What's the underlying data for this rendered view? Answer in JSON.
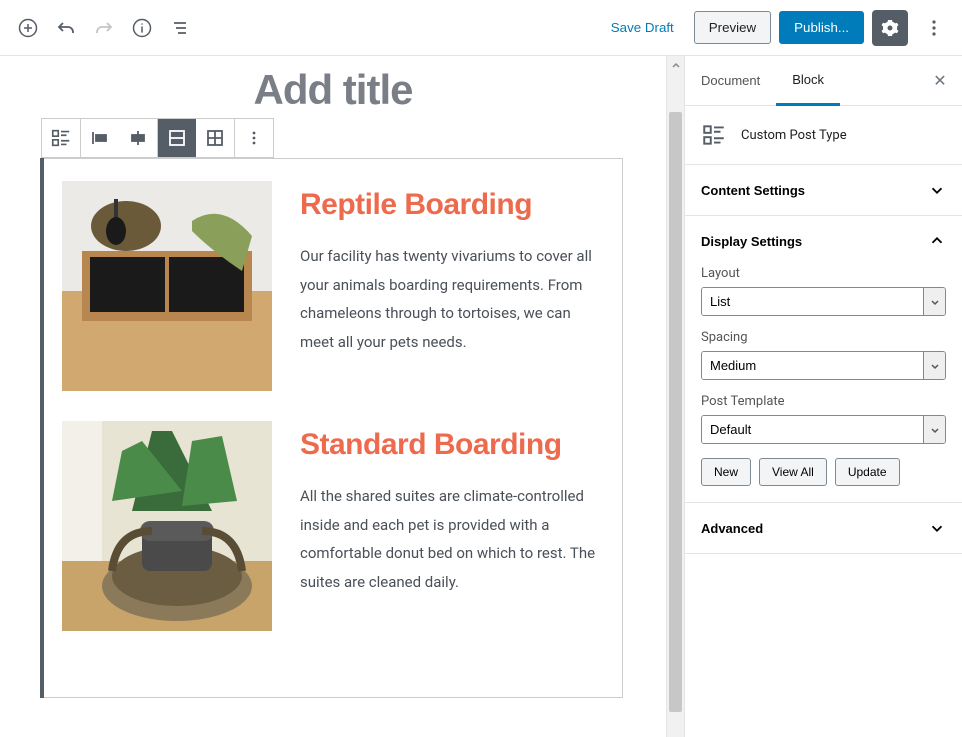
{
  "toolbar": {
    "save_draft": "Save Draft",
    "preview": "Preview",
    "publish": "Publish..."
  },
  "editor": {
    "title_placeholder": "Add title"
  },
  "posts": [
    {
      "title": "Reptile Boarding",
      "body": "Our facility has twenty vivariums to cover all your animals boarding requirements. From chameleons through to tortoises, we can meet all your pets needs."
    },
    {
      "title": "Standard Boarding",
      "body": "All the shared suites are climate-controlled inside and each pet is provided with a comfortable donut bed on which to rest. The suites are cleaned daily."
    }
  ],
  "sidebar": {
    "tabs": {
      "document": "Document",
      "block": "Block"
    },
    "block_type_label": "Custom Post Type",
    "panels": {
      "content_settings": "Content Settings",
      "display_settings": "Display Settings",
      "advanced": "Advanced"
    },
    "fields": {
      "layout": {
        "label": "Layout",
        "value": "List"
      },
      "spacing": {
        "label": "Spacing",
        "value": "Medium"
      },
      "post_template": {
        "label": "Post Template",
        "value": "Default"
      }
    },
    "buttons": {
      "new": "New",
      "view_all": "View All",
      "update": "Update"
    }
  }
}
